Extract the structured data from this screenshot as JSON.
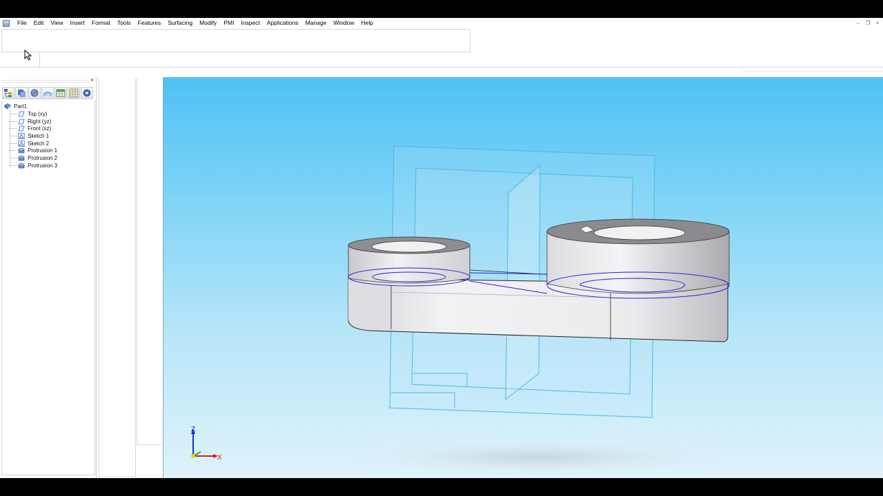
{
  "menu": {
    "items": [
      "File",
      "Edit",
      "View",
      "Insert",
      "Format",
      "Tools",
      "Features",
      "Surfacing",
      "Modify",
      "PMI",
      "Inspect",
      "Applications",
      "Manage",
      "Window",
      "Help"
    ]
  },
  "tree": {
    "root": "Part1",
    "items": [
      {
        "label": "Top (xy)",
        "icon": "plane-icon"
      },
      {
        "label": "Right (yz)",
        "icon": "plane-icon"
      },
      {
        "label": "Front (xz)",
        "icon": "plane-icon"
      },
      {
        "label": "Sketch 1",
        "icon": "sketch-icon"
      },
      {
        "label": "Sketch 2",
        "icon": "sketch-icon"
      },
      {
        "label": "Protrusion 1",
        "icon": "protrusion-icon"
      },
      {
        "label": "Protrusion 2",
        "icon": "protrusion-icon"
      },
      {
        "label": "Protrusion 3",
        "icon": "protrusion-icon"
      }
    ]
  },
  "panel_tools": [
    "feature-tree-icon",
    "parts-icon",
    "sketch-tool-icon",
    "surface-icon",
    "table-icon",
    "grid-icon",
    "settings-icon"
  ],
  "triad": {
    "z_label": "Z",
    "x_label": "X"
  },
  "colors": {
    "viewport_top": "#4fc1f4",
    "viewport_bottom": "#dff3fb",
    "sketch_line": "#2222cc",
    "plane_line": "#48b8e8",
    "part_fill": "#e9e9ec"
  }
}
